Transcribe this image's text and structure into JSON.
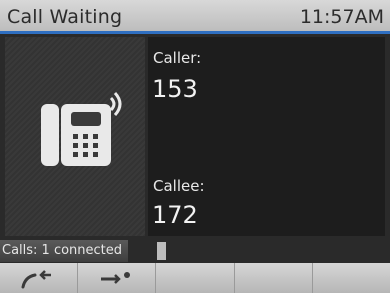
{
  "titlebar": {
    "title": "Call Waiting",
    "time": "11:57AM"
  },
  "call": {
    "caller_label": "Caller:",
    "caller_number": "153",
    "callee_label": "Callee:",
    "callee_number": "172"
  },
  "status": {
    "text": "Calls: 1 connected"
  },
  "softkeys": [
    {
      "icon": "call-back-icon"
    },
    {
      "icon": "redirect-icon"
    },
    {
      "icon": ""
    },
    {
      "icon": ""
    },
    {
      "icon": ""
    }
  ],
  "colors": {
    "accent_blue": "#2f6fc1",
    "titlebar": "#c8c8c8",
    "info_panel": "#1d1d1d",
    "text_light": "#f2f2f2"
  }
}
